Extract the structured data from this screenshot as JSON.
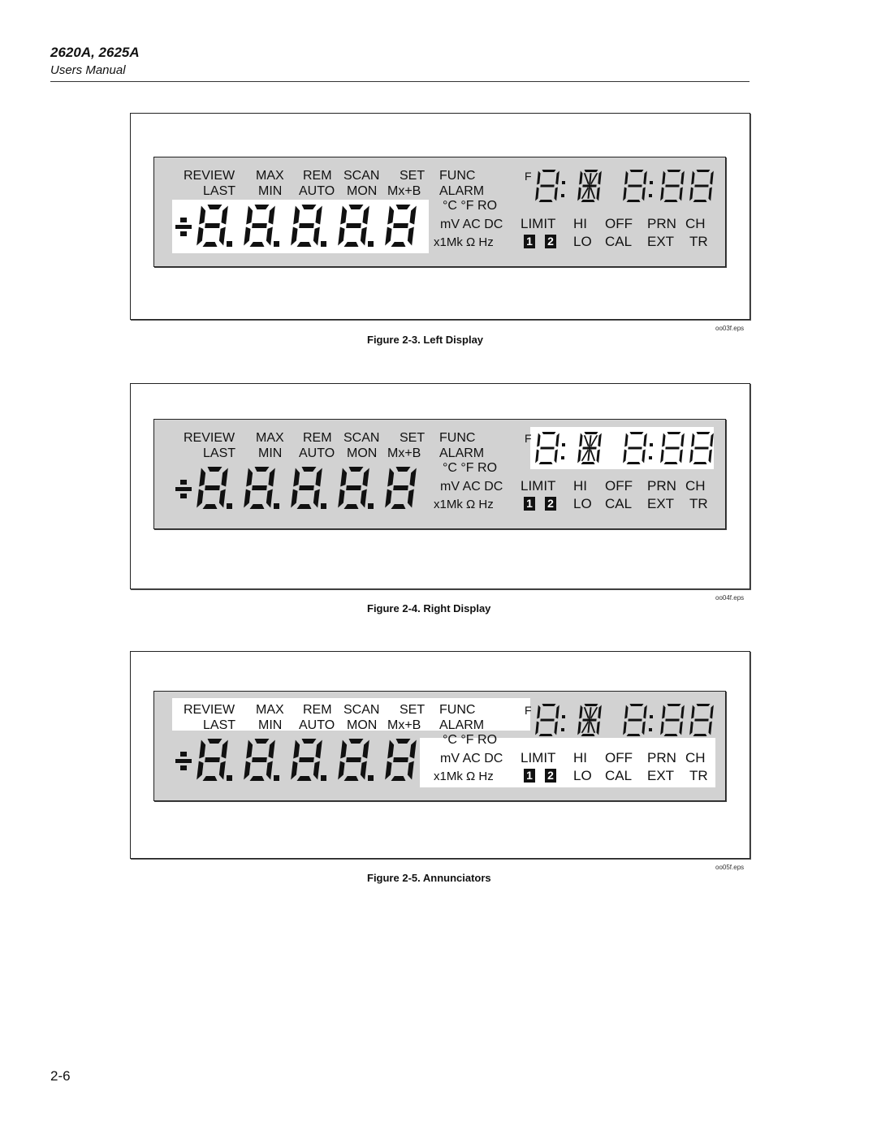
{
  "header": {
    "title": "2620A, 2625A",
    "subtitle": "Users Manual"
  },
  "page_number": "2-6",
  "colors": {
    "lcd_background": "#d2d2d2",
    "highlight": "#ffffff",
    "segment": "#111111"
  },
  "annunciators": {
    "row1": [
      "REVIEW",
      "MAX",
      "REM",
      "SCAN",
      "SET",
      "FUNC"
    ],
    "row2": [
      "LAST",
      "MIN",
      "AUTO",
      "MON",
      "Mx+B",
      "ALARM"
    ],
    "temp": "°C °F RO",
    "units1": "mV AC DC",
    "units2": "x1Mk Ω Hz",
    "f_label": "F",
    "limit": "LIMIT",
    "hi": "HI",
    "lo": "LO",
    "off": "OFF",
    "cal": "CAL",
    "prn": "PRN",
    "ext": "EXT",
    "ch": "CH",
    "tr": "TR",
    "box1": "1",
    "box2": "2"
  },
  "left_display": {
    "sign": "±",
    "digits": [
      "8.",
      "8.",
      "8.",
      "8.",
      "8"
    ]
  },
  "right_display": {
    "digits": [
      "8:",
      "8",
      "8:",
      "8",
      "8"
    ]
  },
  "figures": [
    {
      "caption": "Figure 2-3. Left Display",
      "eps": "oo03f.eps",
      "highlight": "left-display"
    },
    {
      "caption": "Figure 2-4. Right Display",
      "eps": "oo04f.eps",
      "highlight": "right-display"
    },
    {
      "caption": "Figure 2-5. Annunciators",
      "eps": "oo05f.eps",
      "highlight": "annunciators"
    }
  ]
}
